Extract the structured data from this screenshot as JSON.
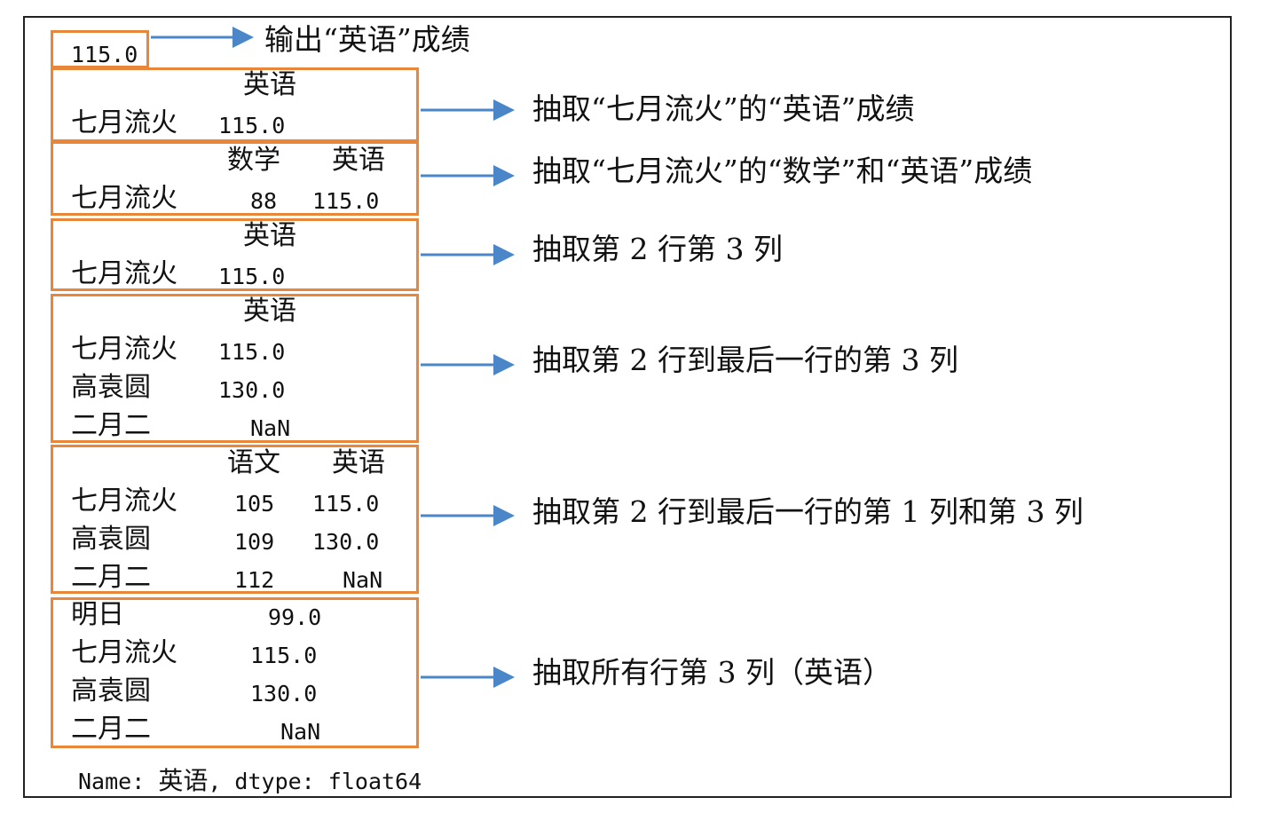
{
  "outputs": {
    "o1": {
      "value": "115.0"
    },
    "o2": {
      "header": "英语",
      "row_label": "七月流火",
      "value": "115.0"
    },
    "o3": {
      "header_a": "数学",
      "header_b": "英语",
      "row_label": "七月流火",
      "value_a": "88",
      "value_b": "115.0"
    },
    "o4": {
      "header": "英语",
      "row_label": "七月流火",
      "value": "115.0"
    },
    "o5": {
      "header": "英语",
      "rows": [
        {
          "label": "七月流火",
          "value": "115.0"
        },
        {
          "label": "高袁圆",
          "value": "130.0"
        },
        {
          "label": "二月二",
          "value": "NaN"
        }
      ]
    },
    "o6": {
      "header_a": "语文",
      "header_b": "英语",
      "rows": [
        {
          "label": "七月流火",
          "a": "105",
          "b": "115.0"
        },
        {
          "label": "高袁圆",
          "a": "109",
          "b": "130.0"
        },
        {
          "label": "二月二",
          "a": "112",
          "b": "NaN"
        }
      ]
    },
    "o7": {
      "rows": [
        {
          "label": "明日",
          "value": "99.0"
        },
        {
          "label": "七月流火",
          "value": "115.0"
        },
        {
          "label": "高袁圆",
          "value": "130.0"
        },
        {
          "label": "二月二",
          "value": "NaN"
        }
      ],
      "footer_prefix": "Name: ",
      "footer_name": "英语",
      "footer_suffix": ", dtype: float64"
    }
  },
  "descriptions": [
    "输出“英语”成绩",
    "抽取“七月流火”的“英语”成绩",
    "抽取“七月流火”的“数学”和“英语”成绩",
    "抽取第 2 行第 3 列",
    "抽取第 2 行到最后一行的第 3 列",
    "抽取第 2 行到最后一行的第 1 列和第 3 列",
    "抽取所有行第 3 列（英语）"
  ],
  "colors": {
    "box_border": "#e8873a",
    "arrow": "#4a86c8",
    "frame": "#222222"
  }
}
